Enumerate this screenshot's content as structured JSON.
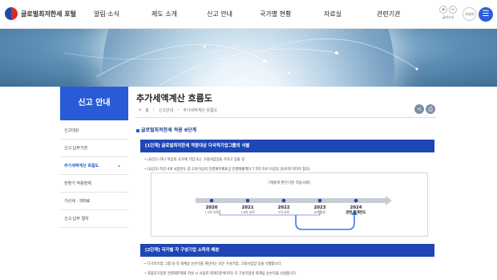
{
  "header": {
    "logo_text": "글로벌최저한세 포털",
    "nav": [
      "알림·소식",
      "제도 소개",
      "신고 안내",
      "국가별 현황",
      "자료실",
      "관련기관"
    ],
    "font_size_label": "글자크기",
    "font_plus": "+",
    "font_minus": "−",
    "lang_label": "국내외",
    "menu_icon": "☰"
  },
  "sidebar": {
    "title": "신고 안내",
    "items": [
      {
        "label": "신고대상",
        "active": false
      },
      {
        "label": "신고·납부기한",
        "active": false
      },
      {
        "label": "추가세액계산 흐름도",
        "active": true
      },
      {
        "label": "전환기 적용면제",
        "active": false
      },
      {
        "label": "가산세 · 과태료",
        "active": false
      },
      {
        "label": "신고·납부 절차",
        "active": false
      }
    ],
    "active_chevron": "›"
  },
  "content": {
    "page_title": "추가세액계산 흐름도",
    "breadcrumb": [
      "홈",
      "신고안내",
      "추가세액계산 흐름도"
    ],
    "home_icon": "⌂",
    "section_heading": "글로벌최저한세 적용 6단계",
    "step1": {
      "title": "[1단계] 글로벌최저한세 적용대상 다국적기업그룹의 식별",
      "bullets": [
        "(요건1) 하나 이상의 국가에 기업 또는 고정사업장을 가지고 있을 것",
        "(요건2) 직전 4개 사업연도 중 2개 이상의 연결재무제표상 연결매출액이 7.5억 유로 이상일 것(아래 이미지 참조)"
      ],
      "chart_caption": "[매출액 판단기준 적용사례]",
      "timeline": [
        {
          "year": "2020",
          "value": "7.2억 유로"
        },
        {
          "year": "2021",
          "value": "7.6억 유로"
        },
        {
          "year": "2022",
          "value": "7억 유로"
        },
        {
          "year": "2023",
          "value": "8억 유로"
        },
        {
          "year": "2024",
          "value": "관련 회계연도"
        }
      ]
    },
    "step2": {
      "title": "[2단계] 국가별 각 구성기업 소득의 배분",
      "bullets": [
        "다국적기업 그룹 내 각 회계상 순손익을 계산하는 모든 구성기업, 고정사업장 등을 식별합니다.",
        "최종모기업의 연결재무제표 작성 시 사용한 회계기준에 따라 각 구성기업의 회계상 순손익을 산정합니다."
      ]
    }
  },
  "colors": {
    "primary": "#2a5bd6",
    "box_head": "#1f46b5",
    "timeline_arrow": "#c8ccd4",
    "loop_arrow": "#3a7de0"
  }
}
